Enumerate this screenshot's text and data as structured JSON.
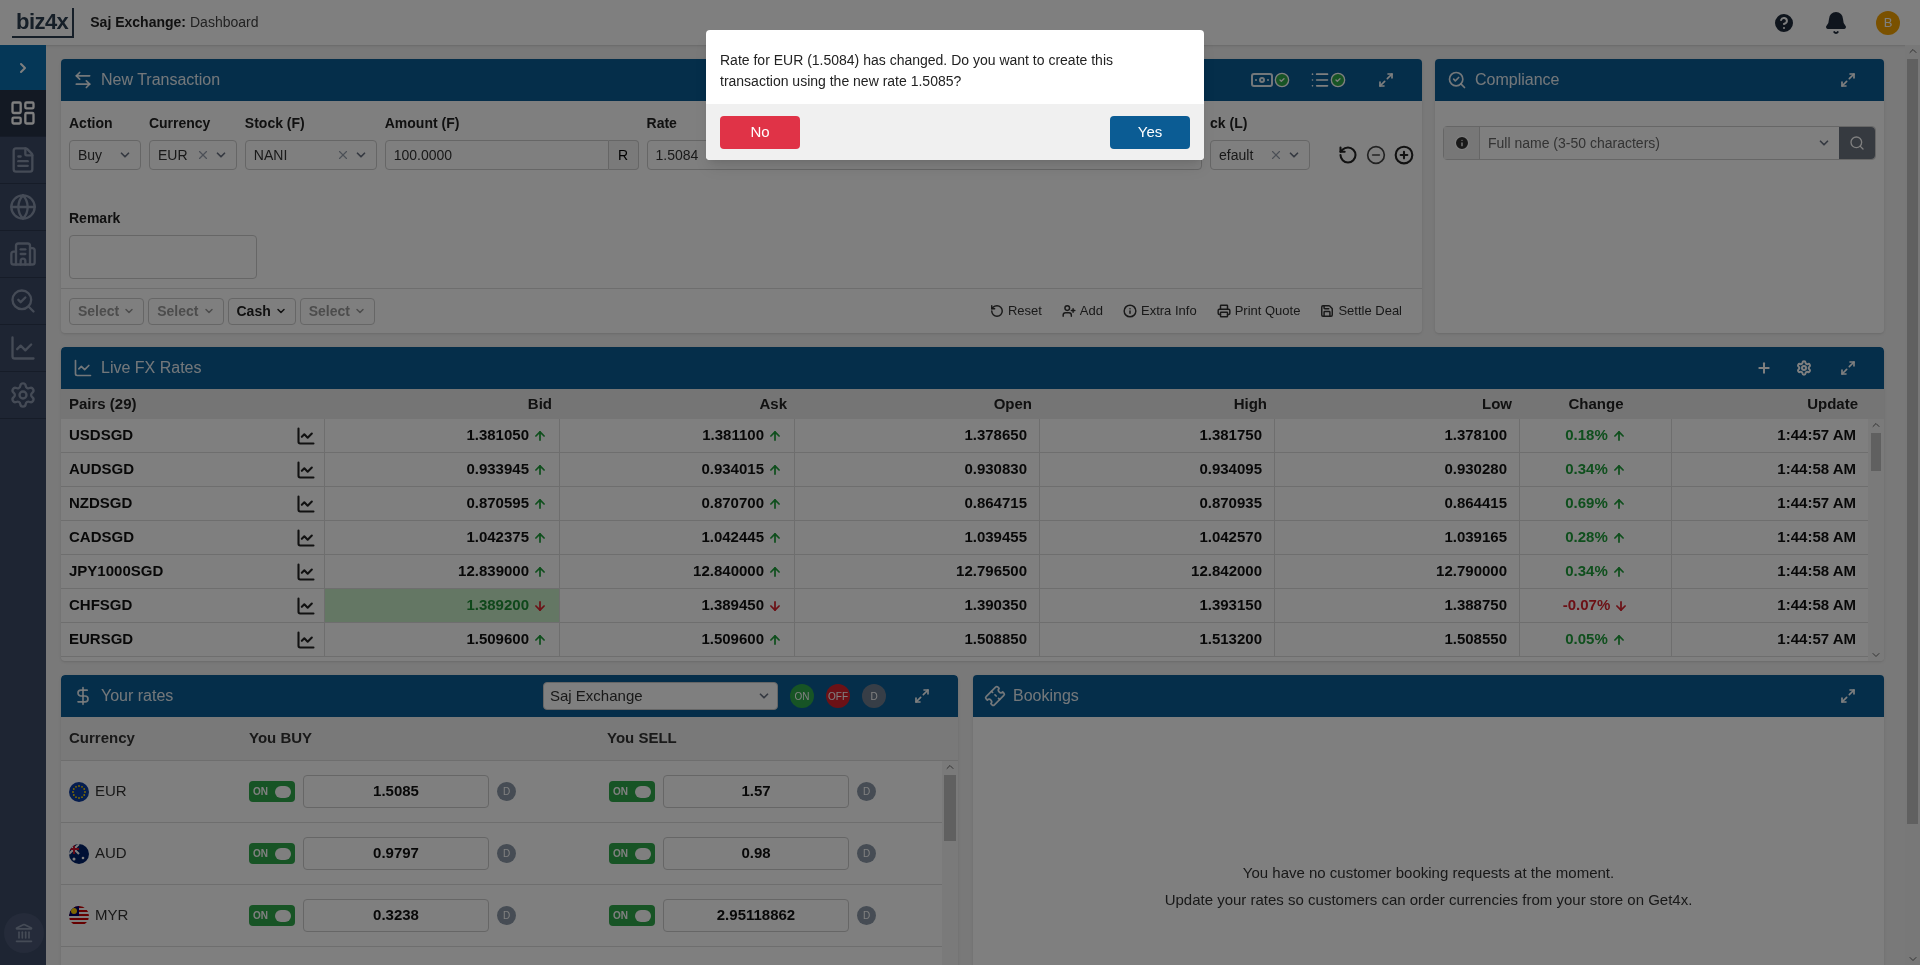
{
  "header": {
    "logo": "biz4x",
    "company": "Saj Exchange:",
    "page": "Dashboard",
    "avatar": "B"
  },
  "sidebar": {
    "items": [
      {
        "kind": "dashboard",
        "selected": true
      },
      {
        "kind": "invoice",
        "selected": false
      },
      {
        "kind": "globe",
        "selected": false
      },
      {
        "kind": "buildings",
        "selected": false
      },
      {
        "kind": "search",
        "selected": false
      },
      {
        "kind": "chart",
        "selected": false
      },
      {
        "kind": "settings",
        "selected": false
      }
    ]
  },
  "new_transaction": {
    "title": "New Transaction",
    "fields": [
      {
        "label": "Action",
        "value": "Buy",
        "kind": "select",
        "clearable": false
      },
      {
        "label": "Currency",
        "value": "EUR",
        "kind": "select",
        "clearable": true
      },
      {
        "label": "Stock (F)",
        "value": "NANI",
        "kind": "select",
        "clearable": true
      },
      {
        "label": "Amount (F)",
        "value": "100.0000",
        "kind": "amount",
        "suffix": "R"
      },
      {
        "label": "Rate",
        "value": "1.5084",
        "kind": "input"
      }
    ],
    "stock_local": {
      "label": "ck (L)",
      "value": "efault",
      "clearable": true
    },
    "remark_label": "Remark",
    "dropdowns": [
      {
        "text": "Select",
        "is_placeholder": true
      },
      {
        "text": "Select",
        "is_placeholder": true
      },
      {
        "text": "Cash",
        "is_placeholder": false
      },
      {
        "text": "Select",
        "is_placeholder": true
      }
    ],
    "actions": [
      {
        "label": "Reset",
        "kind": "reset"
      },
      {
        "label": "Add",
        "kind": "add-user"
      },
      {
        "label": "Extra Info",
        "kind": "info"
      },
      {
        "label": "Print Quote",
        "kind": "print"
      },
      {
        "label": "Settle Deal",
        "kind": "save"
      }
    ]
  },
  "compliance": {
    "title": "Compliance",
    "search": {
      "placeholder": "Full name (3-50 characters)"
    }
  },
  "live_fx": {
    "title": "Live FX Rates",
    "columns": [
      "Pairs (29)",
      "Bid",
      "Ask",
      "Open",
      "High",
      "Low",
      "Change",
      "Update"
    ],
    "rows": [
      {
        "pair": "USDSGD",
        "bid": "1.381050",
        "bid_rising": true,
        "bid_flash": false,
        "ask": "1.381100",
        "ask_rising": true,
        "open": "1.378650",
        "high": "1.381750",
        "low": "1.378100",
        "change": "0.18%",
        "change_rising": true,
        "update": "1:44:57 AM"
      },
      {
        "pair": "AUDSGD",
        "bid": "0.933945",
        "bid_rising": true,
        "bid_flash": false,
        "ask": "0.934015",
        "ask_rising": true,
        "open": "0.930830",
        "high": "0.934095",
        "low": "0.930280",
        "change": "0.34%",
        "change_rising": true,
        "update": "1:44:58 AM"
      },
      {
        "pair": "NZDSGD",
        "bid": "0.870595",
        "bid_rising": true,
        "bid_flash": false,
        "ask": "0.870700",
        "ask_rising": true,
        "open": "0.864715",
        "high": "0.870935",
        "low": "0.864415",
        "change": "0.69%",
        "change_rising": true,
        "update": "1:44:57 AM"
      },
      {
        "pair": "CADSGD",
        "bid": "1.042375",
        "bid_rising": true,
        "bid_flash": false,
        "ask": "1.042445",
        "ask_rising": true,
        "open": "1.039455",
        "high": "1.042570",
        "low": "1.039165",
        "change": "0.28%",
        "change_rising": true,
        "update": "1:44:58 AM"
      },
      {
        "pair": "JPY1000SGD",
        "bid": "12.839000",
        "bid_rising": true,
        "bid_flash": false,
        "ask": "12.840000",
        "ask_rising": true,
        "open": "12.796500",
        "high": "12.842000",
        "low": "12.790000",
        "change": "0.34%",
        "change_rising": true,
        "update": "1:44:58 AM"
      },
      {
        "pair": "CHFSGD",
        "bid": "1.389200",
        "bid_rising": false,
        "bid_flash": true,
        "ask": "1.389450",
        "ask_rising": false,
        "open": "1.390350",
        "high": "1.393150",
        "low": "1.388750",
        "change": "-0.07%",
        "change_rising": false,
        "update": "1:44:58 AM"
      },
      {
        "pair": "EURSGD",
        "bid": "1.509600",
        "bid_rising": true,
        "bid_flash": false,
        "ask": "1.509600",
        "ask_rising": true,
        "open": "1.508850",
        "high": "1.513200",
        "low": "1.508550",
        "change": "0.05%",
        "change_rising": true,
        "update": "1:44:57 AM"
      }
    ]
  },
  "your_rates": {
    "title": "Your rates",
    "store": "Saj Exchange",
    "toggles": [
      {
        "label": "ON",
        "kind": "on"
      },
      {
        "label": "OFF",
        "kind": "off"
      },
      {
        "label": "D",
        "kind": "default"
      }
    ],
    "columns": [
      "Currency",
      "You BUY",
      "You SELL"
    ],
    "rows": [
      {
        "code": "EUR",
        "kind": "eu",
        "buy_switch": {
          "on": true,
          "label": "ON"
        },
        "buy": "1.5085",
        "buy_badge": "D",
        "sell_switch": {
          "on": true,
          "label": "ON"
        },
        "sell": "1.57",
        "sell_badge": "D"
      },
      {
        "code": "AUD",
        "kind": "au",
        "buy_switch": {
          "on": true,
          "label": "ON"
        },
        "buy": "0.9797",
        "buy_badge": "D",
        "sell_switch": {
          "on": true,
          "label": "ON"
        },
        "sell": "0.98",
        "sell_badge": "D"
      },
      {
        "code": "MYR",
        "kind": "my",
        "buy_switch": {
          "on": true,
          "label": "ON"
        },
        "buy": "0.3238",
        "buy_badge": "D",
        "sell_switch": {
          "on": true,
          "label": "ON"
        },
        "sell": "2.95118862",
        "sell_badge": "D"
      }
    ]
  },
  "bookings": {
    "title": "Bookings",
    "message_lines": [
      "You have no customer booking requests at the moment.",
      "Update your rates so customers can order currencies from your store on Get4x."
    ]
  },
  "dialog": {
    "message": "Rate for EUR (1.5084) has changed. Do you want to create this transaction using the new rate 1.5085?",
    "buttons": [
      {
        "label": "No",
        "kind": "cancel"
      },
      {
        "label": "Yes",
        "kind": "confirm"
      }
    ]
  }
}
